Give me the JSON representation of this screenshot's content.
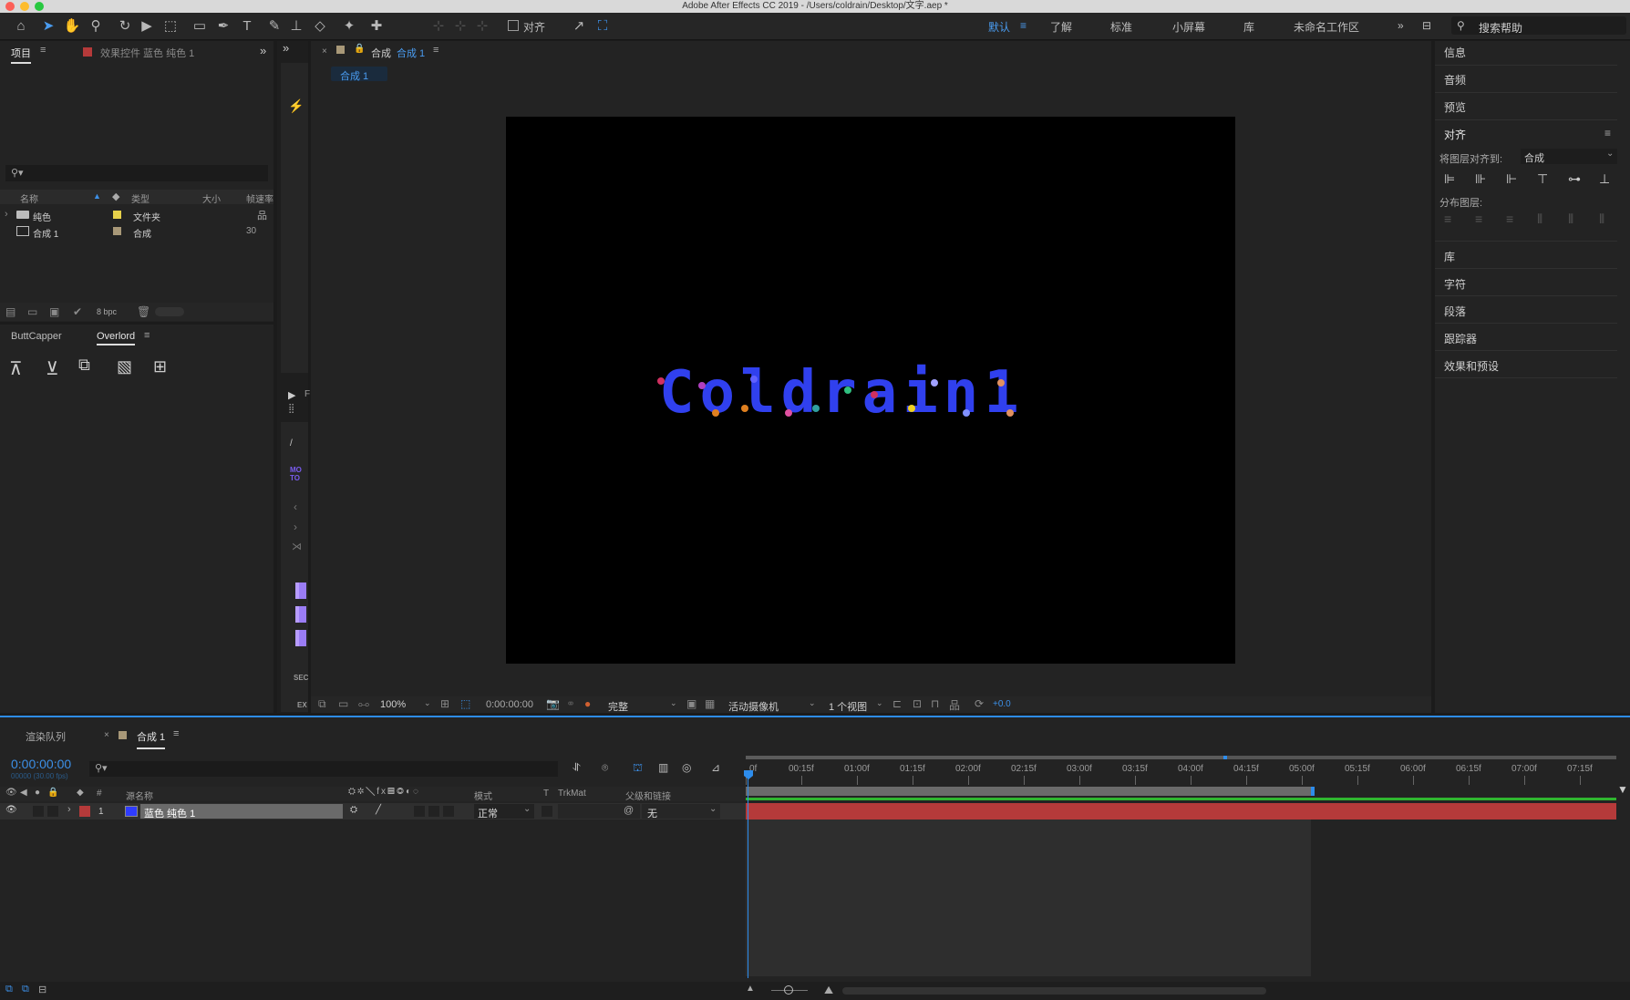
{
  "window_title": "Adobe After Effects CC 2019 - /Users/coldrain/Desktop/文字.aep *",
  "toolbar": {
    "align_label": "对齐",
    "workspaces": [
      "默认",
      "了解",
      "标准",
      "小屏幕",
      "库",
      "未命名工作区"
    ],
    "search_help": "搜索帮助"
  },
  "project_panel": {
    "tab_project": "项目",
    "tab_effects": "效果控件 蓝色 纯色 1",
    "columns": {
      "name": "名称",
      "type": "类型",
      "size": "大小",
      "fps": "帧速率"
    },
    "rows": [
      {
        "name": "纯色",
        "type": "文件夹",
        "fps": ""
      },
      {
        "name": "合成 1",
        "type": "合成",
        "fps": "30"
      }
    ],
    "bpc": "8 bpc"
  },
  "plugins_panel": {
    "tab1": "ButtCapper",
    "tab2": "Overlord"
  },
  "composition": {
    "tab_label": "合成",
    "tab_name": "合成 1",
    "breadcrumb": "合成 1",
    "text": "Coldrain1",
    "footer": {
      "zoom": "100%",
      "timecode": "0:00:00:00",
      "resolution": "完整",
      "camera": "活动摄像机",
      "views": "1 个视图",
      "exposure": "+0.0"
    }
  },
  "right_panels": {
    "items_top": [
      "信息",
      "音频",
      "预览"
    ],
    "align_title": "对齐",
    "align_to_label": "将图层对齐到:",
    "align_to_value": "合成",
    "distribute_label": "分布图层:",
    "items_bottom": [
      "库",
      "字符",
      "段落",
      "跟踪器",
      "效果和预设"
    ]
  },
  "timeline": {
    "tab_render": "渲染队列",
    "tab_comp": "合成 1",
    "timecode": "0:00:00:00",
    "frame_info": "00000 (30.00 fps)",
    "columns": {
      "num": "#",
      "source": "源名称",
      "mode": "模式",
      "t": "T",
      "trkmat": "TrkMat",
      "parent": "父级和链接"
    },
    "layer": {
      "num": "1",
      "name": "蓝色 纯色 1",
      "mode": "正常",
      "parent": "无"
    },
    "ruler_labels": [
      "0f",
      "00:15f",
      "01:00f",
      "01:15f",
      "02:00f",
      "02:15f",
      "03:00f",
      "03:15f",
      "04:00f",
      "04:15f",
      "05:00f",
      "05:15f",
      "06:00f",
      "06:15f",
      "07:00f",
      "07:15f"
    ]
  },
  "side_strip": {
    "letter_f": "F",
    "mo_label": "MO TO",
    "sec_label": "SEC",
    "ex_label": "EX"
  },
  "colors": {
    "accent_blue": "#2d8ceb",
    "layer_red": "#b53a3a",
    "solid_blue": "#2f3cff",
    "text_blue": "#3040ee"
  }
}
